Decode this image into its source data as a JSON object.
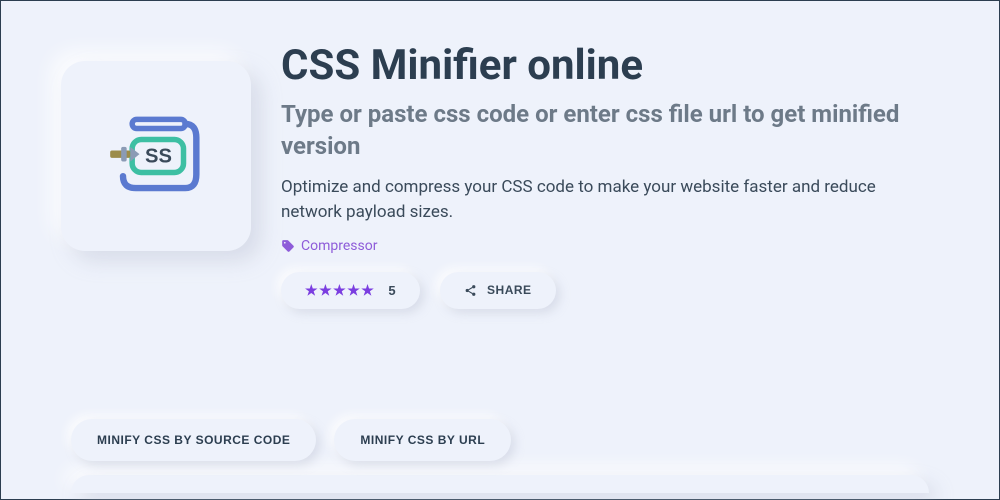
{
  "header": {
    "title": "CSS Minifier online",
    "subtitle": "Type or paste css code or enter css file url to get minified version",
    "description": "Optimize and compress your CSS code to make your website faster and reduce network payload sizes."
  },
  "tag": {
    "label": "Compressor"
  },
  "rating": {
    "value": "5",
    "stars": 5
  },
  "share": {
    "label": "SHARE"
  },
  "tabs": {
    "source": "MINIFY CSS BY SOURCE CODE",
    "url": "MINIFY CSS BY URL"
  }
}
